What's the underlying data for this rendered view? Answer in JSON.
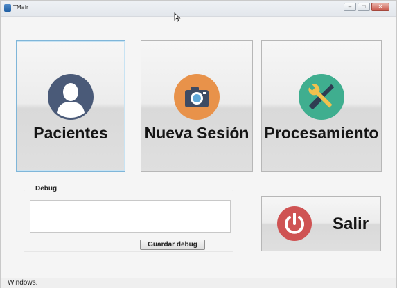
{
  "window": {
    "title": "TMair",
    "controls": {
      "minimize": "–",
      "maximize": "□",
      "close": "✕"
    }
  },
  "buttons": {
    "pacientes": {
      "label": "Pacientes",
      "icon": "user-avatar-icon",
      "color": "#4a5a78"
    },
    "nueva_sesion": {
      "label": "Nueva Sesión",
      "icon": "camera-icon",
      "color": "#e8924a"
    },
    "procesamiento": {
      "label": "Procesamiento",
      "icon": "wrench-screwdriver-icon",
      "color": "#3fae8f"
    },
    "salir": {
      "label": "Salir",
      "icon": "power-icon",
      "color": "#cf5353"
    }
  },
  "debug": {
    "legend": "Debug",
    "value": "",
    "save_label": "Guardar debug"
  },
  "status": {
    "text": "Windows."
  }
}
